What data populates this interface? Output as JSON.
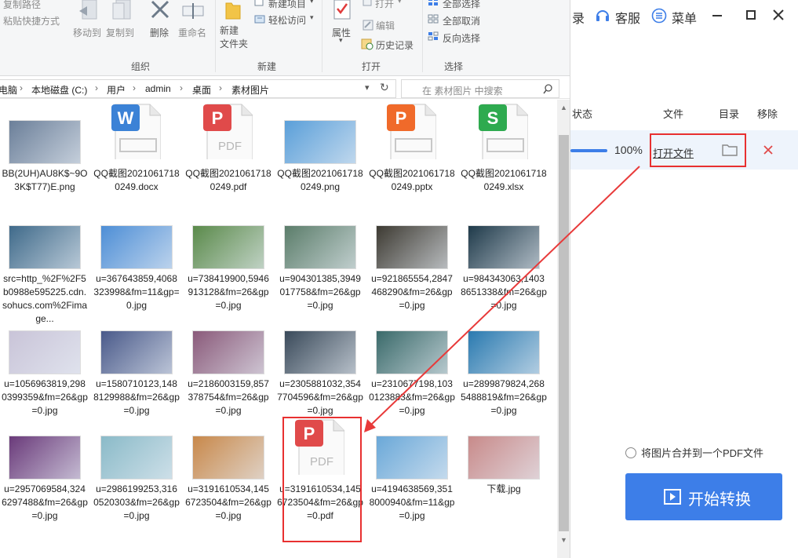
{
  "ribbon": {
    "copy_path": "复制路径",
    "paste_shortcut": "粘贴快捷方式",
    "move_to": "移动到",
    "copy_to": "复制到",
    "delete": "删除",
    "rename": "重命名",
    "new_folder": "新建\n文件夹",
    "new_item": "新建项目",
    "easy_access": "轻松访问",
    "properties": "属性",
    "open": "打开",
    "edit": "编辑",
    "history": "历史记录",
    "select_all": "全部选择",
    "select_none": "全部取消",
    "invert_select": "反向选择",
    "group_organize": "组织",
    "group_new": "新建",
    "group_open": "打开",
    "group_select": "选择"
  },
  "address": {
    "crumbs": [
      "电脑",
      "本地磁盘 (C:)",
      "用户",
      "admin",
      "桌面",
      "素材图片"
    ],
    "search_placeholder": "在 素材图片 中搜索"
  },
  "files": [
    {
      "name": "BB(2UH)AU8K$~9O3K$T77)E.png",
      "kind": "image",
      "color": "#6b7f99"
    },
    {
      "name": "QQ截图20210617180249.docx",
      "kind": "docx",
      "color": "#3b82d6"
    },
    {
      "name": "QQ截图20210617180249.pdf",
      "kind": "pdf",
      "color": "#e04a4a"
    },
    {
      "name": "QQ截图20210617180249.png",
      "kind": "image",
      "color": "#5a9fd9"
    },
    {
      "name": "QQ截图20210617180249.pptx",
      "kind": "pptx",
      "color": "#f06a2a"
    },
    {
      "name": "QQ截图20210617180249.xlsx",
      "kind": "xlsx",
      "color": "#2eaa4f"
    },
    {
      "name": "src=http_%2F%2F5b0988e595225.cdn.sohucs.com%2Fimage...",
      "kind": "image",
      "color": "#3f6a8a"
    },
    {
      "name": "u=367643859,4068323998&fm=11&gp=0.jpg",
      "kind": "image",
      "color": "#4d8ed6"
    },
    {
      "name": "u=738419900,5946913128&fm=26&gp=0.jpg",
      "kind": "image",
      "color": "#5a8a4a"
    },
    {
      "name": "u=904301385,3949017758&fm=26&gp=0.jpg",
      "kind": "image",
      "color": "#5b7d6a"
    },
    {
      "name": "u=921865554,2847468290&fm=26&gp=0.jpg",
      "kind": "image",
      "color": "#3d3a32"
    },
    {
      "name": "u=984343063,14038651338&fm=26&gp=0.jpg",
      "kind": "image",
      "color": "#1f3a4a"
    },
    {
      "name": "u=1056963819,2980399359&fm=26&gp=0.jpg",
      "kind": "image",
      "color": "#c9c4d8"
    },
    {
      "name": "u=1580710123,1488129988&fm=26&gp=0.jpg",
      "kind": "image",
      "color": "#4a5a8a"
    },
    {
      "name": "u=2186003159,857378754&fm=26&gp=0.jpg",
      "kind": "image",
      "color": "#8a5a7a"
    },
    {
      "name": "u=2305881032,3547704596&fm=26&gp=0.jpg",
      "kind": "image",
      "color": "#3a4a5a"
    },
    {
      "name": "u=2310677198,1030123883&fm=26&gp=0.jpg",
      "kind": "image",
      "color": "#3a6a6a"
    },
    {
      "name": "u=2899879824,2685488819&fm=26&gp=0.jpg",
      "kind": "image",
      "color": "#2a7ab0"
    },
    {
      "name": "u=2957069584,3246297488&fm=26&gp=0.jpg",
      "kind": "image",
      "color": "#6a3a7a"
    },
    {
      "name": "u=2986199253,3160520303&fm=26&gp=0.jpg",
      "kind": "image",
      "color": "#8abac8"
    },
    {
      "name": "u=3191610534,1456723504&fm=26&gp=0.jpg",
      "kind": "image",
      "color": "#c8884a"
    },
    {
      "name": "u=3191610534,1456723504&fm=26&gp=0.pdf",
      "kind": "pdf",
      "color": "#e04a4a"
    },
    {
      "name": "u=4194638569,3518000940&fm=11&gp=0.jpg",
      "kind": "image",
      "color": "#6aa8d8"
    },
    {
      "name": "下载.jpg",
      "kind": "image",
      "color": "#c88a8a"
    }
  ],
  "converter": {
    "login": "录",
    "service": "客服",
    "menu": "菜单",
    "col_status": "状态",
    "col_file": "文件",
    "col_dir": "目录",
    "col_remove": "移除",
    "progress_pct": "100%",
    "progress_value": 1.0,
    "open_file": "打开文件",
    "merge_pdf": "将图片合并到一个PDF文件",
    "start": "开始转换",
    "accent": "#3d7ee8"
  }
}
